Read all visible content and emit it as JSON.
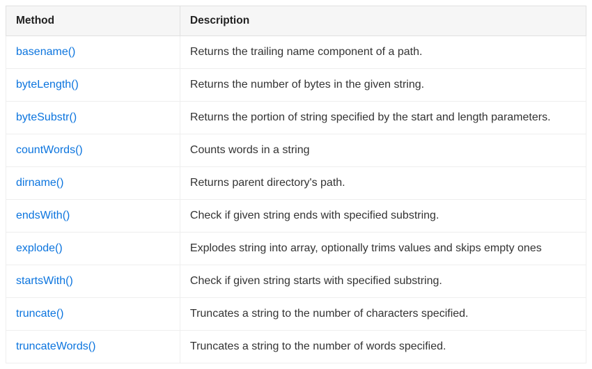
{
  "table": {
    "headers": {
      "method": "Method",
      "description": "Description"
    },
    "rows": [
      {
        "method": "basename()",
        "description": "Returns the trailing name component of a path."
      },
      {
        "method": "byteLength()",
        "description": "Returns the number of bytes in the given string."
      },
      {
        "method": "byteSubstr()",
        "description": "Returns the portion of string specified by the start and length parameters."
      },
      {
        "method": "countWords()",
        "description": "Counts words in a string"
      },
      {
        "method": "dirname()",
        "description": "Returns parent directory's path."
      },
      {
        "method": "endsWith()",
        "description": "Check if given string ends with specified substring."
      },
      {
        "method": "explode()",
        "description": "Explodes string into array, optionally trims values and skips empty ones"
      },
      {
        "method": "startsWith()",
        "description": "Check if given string starts with specified substring."
      },
      {
        "method": "truncate()",
        "description": "Truncates a string to the number of characters specified."
      },
      {
        "method": "truncateWords()",
        "description": "Truncates a string to the number of words specified."
      }
    ]
  }
}
